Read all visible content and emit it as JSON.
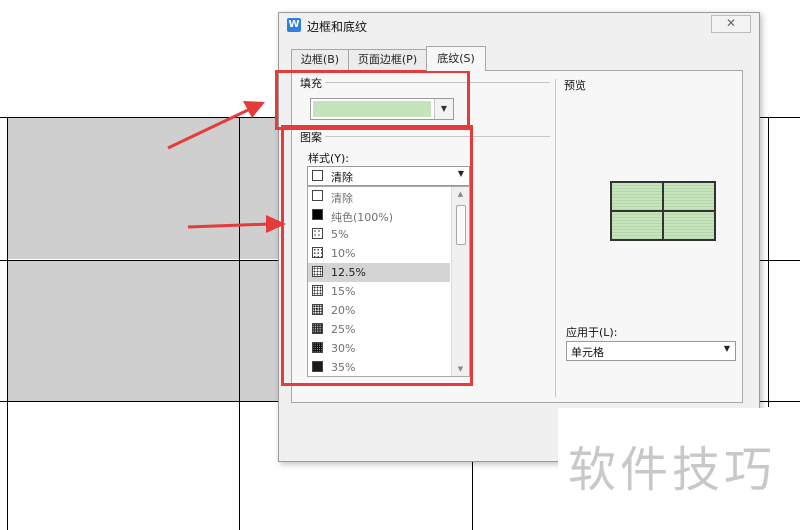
{
  "dialog": {
    "title": "边框和底纹",
    "app_icon_glyph": "W",
    "close_glyph": "✕"
  },
  "tabs": [
    {
      "label": "边框(B)"
    },
    {
      "label": "页面边框(P)"
    },
    {
      "label": "底纹(S)"
    }
  ],
  "fill": {
    "label": "填充",
    "color": "#c6e4bc"
  },
  "pattern": {
    "label": "图案",
    "style_label": "样式(Y):",
    "selected": "清除",
    "items": [
      {
        "label": "清除"
      },
      {
        "label": "纯色(100%)"
      },
      {
        "label": "5%"
      },
      {
        "label": "10%"
      },
      {
        "label": "12.5%"
      },
      {
        "label": "15%"
      },
      {
        "label": "20%"
      },
      {
        "label": "25%"
      },
      {
        "label": "30%"
      },
      {
        "label": "35%"
      }
    ]
  },
  "preview": {
    "label": "预览"
  },
  "apply": {
    "label": "应用于(L):",
    "value": "单元格"
  },
  "watermark": {
    "text": "软件技巧"
  },
  "colors": {
    "accent_red": "#e53b3b",
    "fill_green": "#c6e4bc",
    "cell_gray": "#cfcfcf"
  }
}
